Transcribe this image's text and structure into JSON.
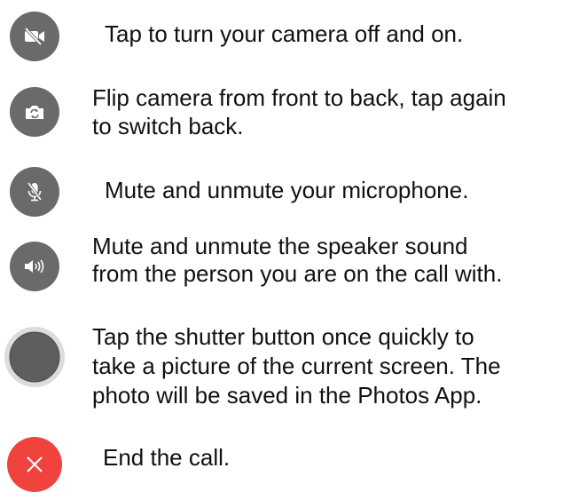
{
  "items": [
    {
      "icon": "video-off-icon",
      "text_lines": [
        "Tap to turn your camera off and on."
      ]
    },
    {
      "icon": "flip-camera-icon",
      "text_lines": [
        "Flip camera from front to back, tap again",
        "to switch back."
      ]
    },
    {
      "icon": "microphone-off-icon",
      "text_lines": [
        "Mute and unmute your microphone."
      ]
    },
    {
      "icon": "speaker-icon",
      "text_lines": [
        "Mute and unmute the speaker sound",
        "from the person you are on the call with."
      ]
    },
    {
      "icon": "shutter-icon",
      "text_lines": [
        "Tap the shutter button once quickly to",
        "take a picture of the current screen. The",
        "photo will be saved in the Photos App."
      ]
    },
    {
      "icon": "close-icon",
      "text_lines": [
        "End the call."
      ]
    }
  ],
  "colors": {
    "button_gray": "#6a6a6a",
    "end_call_red": "#f0433e",
    "shutter_ring": "#dcdcdc",
    "shutter_fill": "#5e5e5e",
    "text": "#111111"
  }
}
